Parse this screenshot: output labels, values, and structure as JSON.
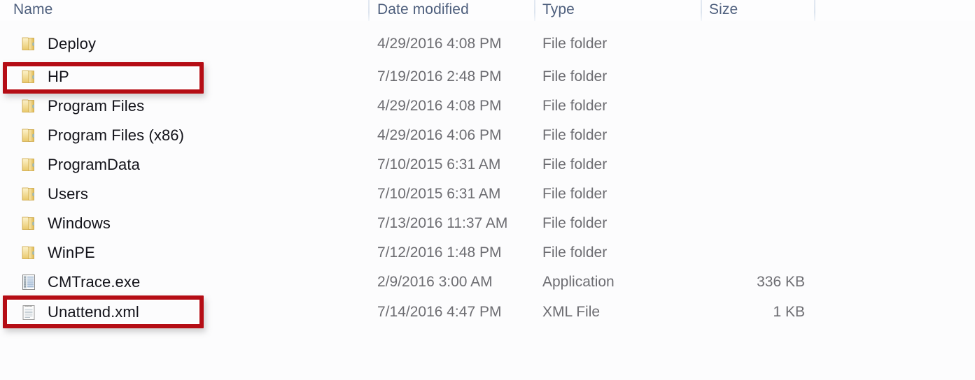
{
  "columns": {
    "name": "Name",
    "date_modified": "Date modified",
    "type": "Type",
    "size": "Size"
  },
  "colors": {
    "highlight": "#b50d15",
    "header_text": "#4e5f7d",
    "name_text": "#13131a",
    "meta_text": "#6d6d72",
    "folder_icon": "#e8c96a"
  },
  "rows": [
    {
      "name": "Deploy",
      "date_modified": "4/29/2016 4:08 PM",
      "type": "File folder",
      "size": "",
      "icon": "folder-icon",
      "highlighted": false
    },
    {
      "name": "HP",
      "date_modified": "7/19/2016 2:48 PM",
      "type": "File folder",
      "size": "",
      "icon": "folder-icon",
      "highlighted": true
    },
    {
      "name": "Program Files",
      "date_modified": "4/29/2016 4:08 PM",
      "type": "File folder",
      "size": "",
      "icon": "folder-icon",
      "highlighted": false
    },
    {
      "name": "Program Files (x86)",
      "date_modified": "4/29/2016 4:06 PM",
      "type": "File folder",
      "size": "",
      "icon": "folder-icon",
      "highlighted": false
    },
    {
      "name": "ProgramData",
      "date_modified": "7/10/2015 6:31 AM",
      "type": "File folder",
      "size": "",
      "icon": "folder-icon",
      "highlighted": false
    },
    {
      "name": "Users",
      "date_modified": "7/10/2015 6:31 AM",
      "type": "File folder",
      "size": "",
      "icon": "folder-icon",
      "highlighted": false
    },
    {
      "name": "Windows",
      "date_modified": "7/13/2016 11:37 AM",
      "type": "File folder",
      "size": "",
      "icon": "folder-icon",
      "highlighted": false
    },
    {
      "name": "WinPE",
      "date_modified": "7/12/2016 1:48 PM",
      "type": "File folder",
      "size": "",
      "icon": "folder-icon",
      "highlighted": false
    },
    {
      "name": "CMTrace.exe",
      "date_modified": "2/9/2016 3:00 AM",
      "type": "Application",
      "size": "336 KB",
      "icon": "application-icon",
      "highlighted": false
    },
    {
      "name": "Unattend.xml",
      "date_modified": "7/14/2016 4:47 PM",
      "type": "XML File",
      "size": "1 KB",
      "icon": "xml-document-icon",
      "highlighted": true
    }
  ],
  "annotations": [
    {
      "label": "HP"
    },
    {
      "label": "Unattend.xml"
    }
  ]
}
